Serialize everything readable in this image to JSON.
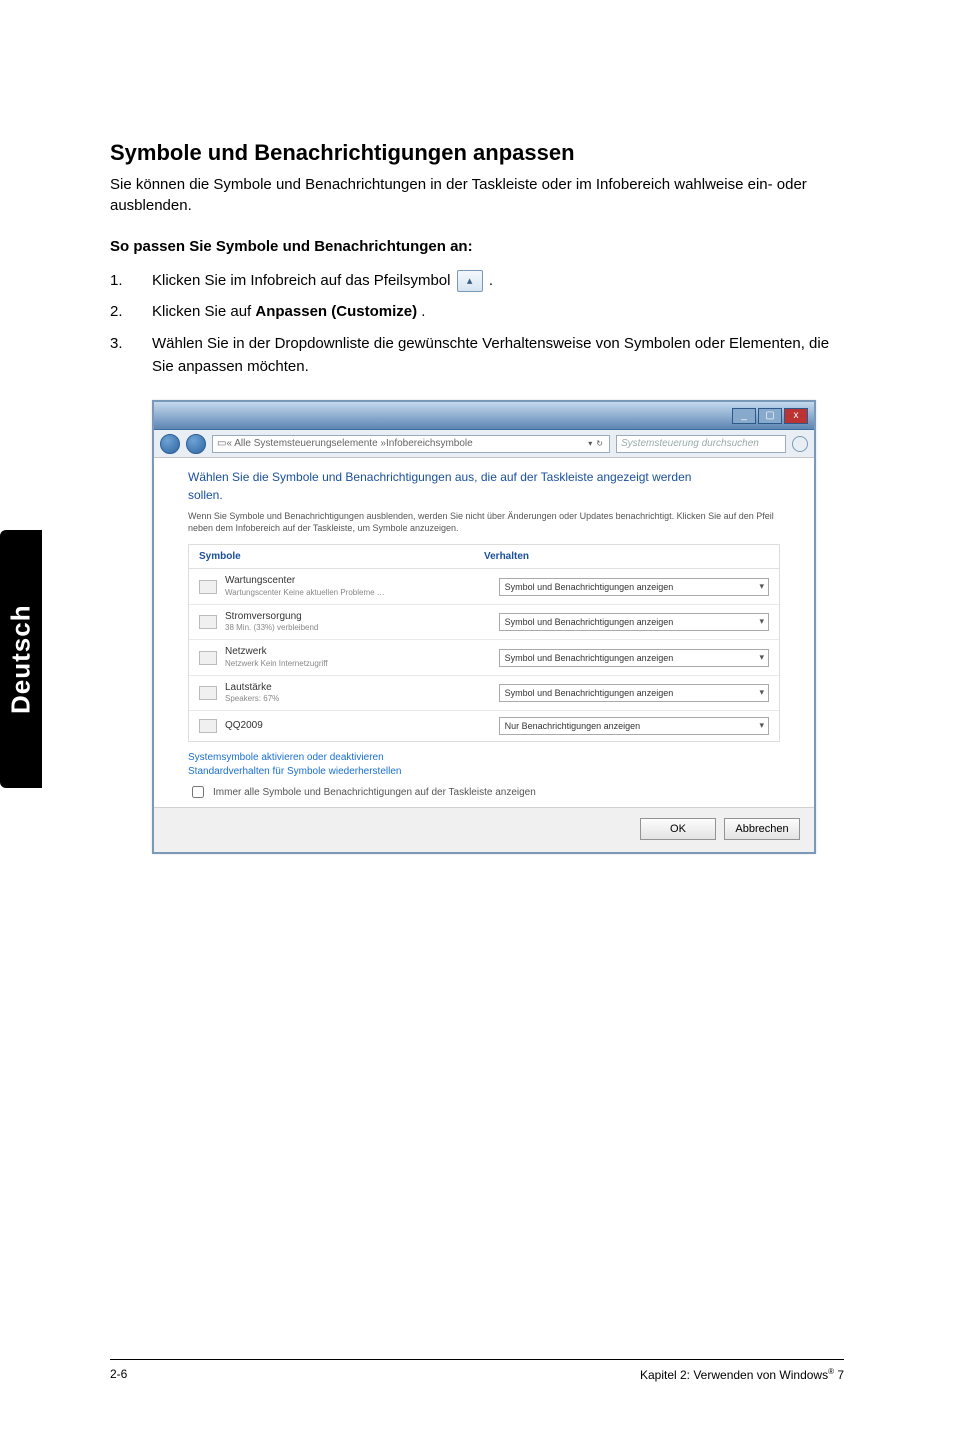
{
  "heading": "Symbole und Benachrichtigungen anpassen",
  "intro": "Sie können die Symbole und Benachrichtungen in der Taskleiste oder im Infobereich wahlweise ein- oder ausblenden.",
  "subheading": "So passen Sie Symbole und Benachrichtungen an:",
  "steps": {
    "s1a": "Klicken Sie im Infobreich auf das Pfeilsymbol ",
    "s1b": ".",
    "s2a": "Klicken Sie auf ",
    "s2b": "Anpassen (Customize)",
    "s2c": ".",
    "s3": "Wählen Sie in der Dropdownliste die gewünschte Verhaltensweise von Symbolen oder Elementen, die Sie anpassen möchten."
  },
  "sidebar_tab": "Deutsch",
  "window": {
    "breadcrumb_prefix": "« Alle Systemsteuerungselemente »",
    "breadcrumb_leaf": "Infobereichsymbole",
    "search_placeholder": "Systemsteuerung durchsuchen",
    "title_line": "Wählen Sie die Symbole und Benachrichtigungen aus, die auf der Taskleiste angezeigt werden",
    "title_suffix": "sollen.",
    "help_text": "Wenn Sie Symbole und Benachrichtigungen ausblenden, werden Sie nicht über Änderungen oder Updates benachrichtigt. Klicken Sie auf den Pfeil neben dem Infobereich auf der Taskleiste, um Symbole anzuzeigen.",
    "col_symbols": "Symbole",
    "col_behavior": "Verhalten",
    "rows": [
      {
        "title": "Wartungscenter",
        "sub": "Wartungscenter  Keine aktuellen Probleme …",
        "opt": "Symbol und Benachrichtigungen anzeigen"
      },
      {
        "title": "Stromversorgung",
        "sub": "38 Min. (33%) verbleibend",
        "opt": "Symbol und Benachrichtigungen anzeigen"
      },
      {
        "title": "Netzwerk",
        "sub": "Netzwerk  Kein Internetzugriff",
        "opt": "Symbol und Benachrichtigungen anzeigen"
      },
      {
        "title": "Lautstärke",
        "sub": "Speakers: 67%",
        "opt": "Symbol und Benachrichtigungen anzeigen"
      },
      {
        "title": "QQ2009",
        "sub": "",
        "opt": "Nur Benachrichtigungen anzeigen"
      }
    ],
    "link1": "Systemsymbole aktivieren oder deaktivieren",
    "link2": "Standardverhalten für Symbole wiederherstellen",
    "checkbox": "Immer alle Symbole und Benachrichtigungen auf der Taskleiste anzeigen",
    "ok": "OK",
    "cancel": "Abbrechen"
  },
  "footer": {
    "left": "2-6",
    "right_a": "Kapitel 2: Verwenden von Windows",
    "right_b": " 7"
  }
}
